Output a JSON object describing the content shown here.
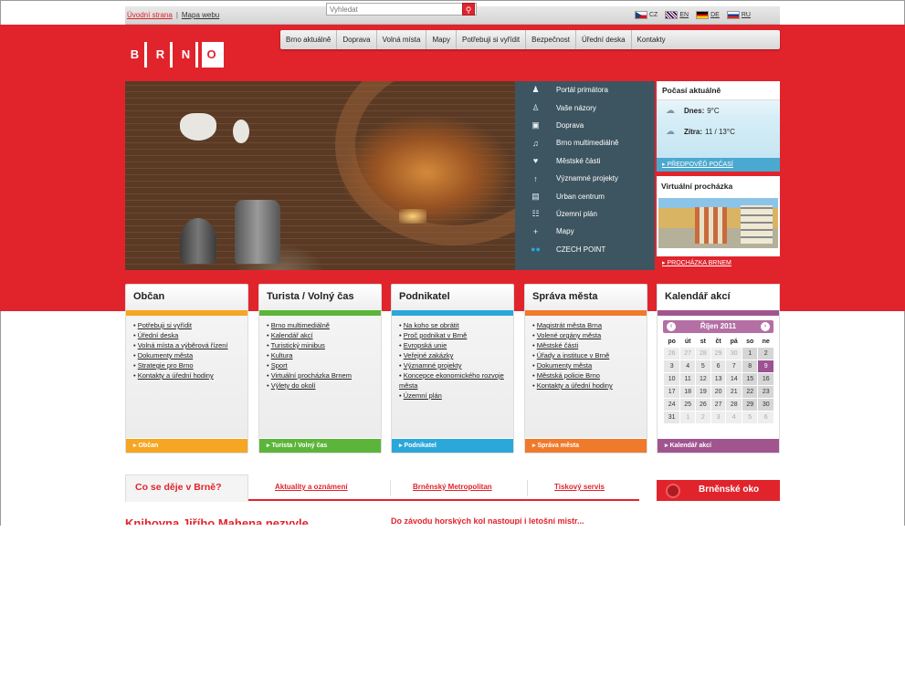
{
  "topbar": {
    "home_link": "Úvodní strana",
    "separator": "|",
    "sitemap_link": "Mapa webu",
    "search_placeholder": "Vyhledat",
    "languages": [
      {
        "code": "CZ",
        "flag": "cz"
      },
      {
        "code": "EN",
        "flag": "en"
      },
      {
        "code": "DE",
        "flag": "de"
      },
      {
        "code": "RU",
        "flag": "ru"
      }
    ]
  },
  "logo": [
    "B",
    "R",
    "N",
    "O"
  ],
  "main_nav": [
    "Brno aktuálně",
    "Doprava",
    "Volná místa",
    "Mapy",
    "Potřebuji si vyřídit",
    "Bezpečnost",
    "Úřední deska",
    "Kontakty"
  ],
  "quick_menu": [
    {
      "label": "Portál primátora",
      "icon": "person-icon"
    },
    {
      "label": "Vaše názory",
      "icon": "speech-icon"
    },
    {
      "label": "Doprava",
      "icon": "bus-icon"
    },
    {
      "label": "Brno multimediálně",
      "icon": "media-icon"
    },
    {
      "label": "Městské části",
      "icon": "districts-icon"
    },
    {
      "label": "Významné projekty",
      "icon": "projects-icon"
    },
    {
      "label": "Urban centrum",
      "icon": "urban-icon"
    },
    {
      "label": "Územní plán",
      "icon": "plan-icon"
    },
    {
      "label": "Mapy",
      "icon": "plus-icon"
    },
    {
      "label": "CZECH POINT",
      "icon": "czechpoint-icon"
    }
  ],
  "weather": {
    "title": "Počasí aktuálně",
    "today_label": "Dnes:",
    "today_value": "9°C",
    "tomorrow_label": "Zítra:",
    "tomorrow_value": "11 / 13°C",
    "forecast_link": "PŘEDPOVĚĎ POČASÍ"
  },
  "virtual_tour": {
    "title": "Virtuální procházka",
    "link": "PROCHÁZKA BRNEM"
  },
  "categories": [
    {
      "title": "Občan",
      "color": "#f5a623",
      "links": [
        "Potřebuji si vyřídit",
        "Úřední deska",
        "Volná místa a výběrová řízení",
        "Dokumenty města",
        "Strategie pro Brno",
        "Kontakty a úřední hodiny"
      ],
      "footer": "Občan"
    },
    {
      "title": "Turista / Volný čas",
      "color": "#5cb53a",
      "links": [
        "Brno multimediálně",
        "Kalendář akcí",
        "Turistický minibus",
        "Kultura",
        "Sport",
        "Virtuální procházka Brnem",
        "Výlety do okolí"
      ],
      "footer": "Turista / Volný čas"
    },
    {
      "title": "Podnikatel",
      "color": "#2ba7da",
      "links": [
        "Na koho se obrátit",
        "Proč podnikat v Brně",
        "Evropská unie",
        "Veřejné zakázky",
        "Významné projekty",
        "Koncepce ekonomického rozvoje města",
        "Územní plán"
      ],
      "footer": "Podnikatel"
    },
    {
      "title": "Správa města",
      "color": "#f07a2c",
      "links": [
        "Magistrát města Brna",
        "Volené orgány města",
        "Městské části",
        "Úřady a instituce v Brně",
        "Dokumenty města",
        "Městská policie Brno",
        "Kontakty a úřední hodiny"
      ],
      "footer": "Správa města"
    }
  ],
  "calendar": {
    "title": "Kalendář akcí",
    "month": "Říjen 2011",
    "prev": "‹",
    "next": "›",
    "days": [
      "po",
      "út",
      "st",
      "čt",
      "pá",
      "so",
      "ne"
    ],
    "weeks": [
      [
        "26",
        "27",
        "28",
        "29",
        "30",
        "1",
        "2"
      ],
      [
        "3",
        "4",
        "5",
        "6",
        "7",
        "8",
        "9"
      ],
      [
        "10",
        "11",
        "12",
        "13",
        "14",
        "15",
        "16"
      ],
      [
        "17",
        "18",
        "19",
        "20",
        "21",
        "22",
        "23"
      ],
      [
        "24",
        "25",
        "26",
        "27",
        "28",
        "29",
        "30"
      ],
      [
        "31",
        "1",
        "2",
        "3",
        "4",
        "5",
        "6"
      ]
    ],
    "today": "9",
    "footer": "Kalendář akcí"
  },
  "tabs": {
    "active": "Co se děje v Brně?",
    "items": [
      "Aktuality a oznámení",
      "Brněnský Metropolitan",
      "Tiskový servis"
    ]
  },
  "oko_button": "Brněnské oko",
  "headlines": [
    "Knihovna Jiřího Mahena nezvyle...",
    "Do závodu horských kol nastoupí i letošní mistr..."
  ]
}
